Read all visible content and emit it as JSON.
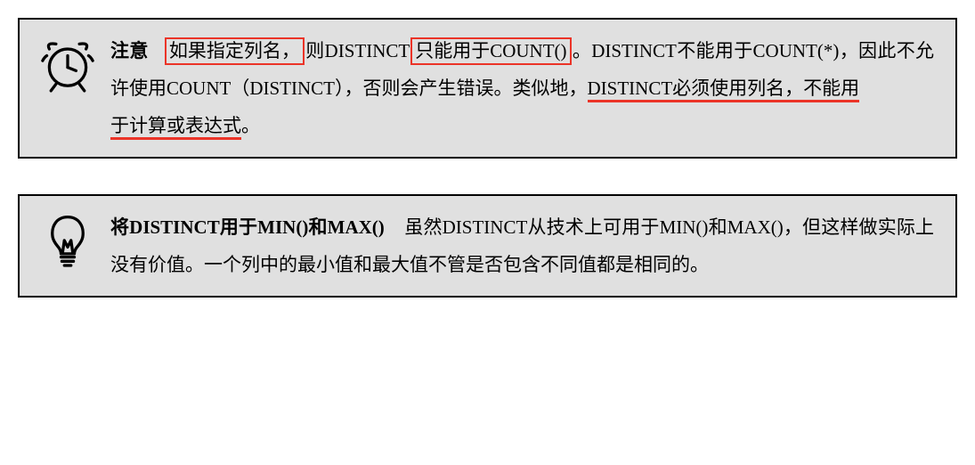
{
  "box1": {
    "title": "注意",
    "hl1_part1": "如果指定列名，",
    "t1": "则",
    "t_distinct1": "DISTINCT",
    "hl1_part2": "只能用于COUNT()",
    "t2": "。",
    "t_distinct2": "DISTINCT",
    "t3": "不能用于COUNT(*)，因此不允许使用COUNT（DISTINCT），否则会产生错误。类似地，",
    "u1": "DISTINCT必须使用列名，不能用",
    "u2": "于计算或表达式",
    "t4": "。"
  },
  "box2": {
    "title": "将DISTINCT用于MIN()和MAX()",
    "body": "虽然DISTINCT从技术上可用于MIN()和MAX()，但这样做实际上没有价值。一个列中的最小值和最大值不管是否包含不同值都是相同的。"
  }
}
